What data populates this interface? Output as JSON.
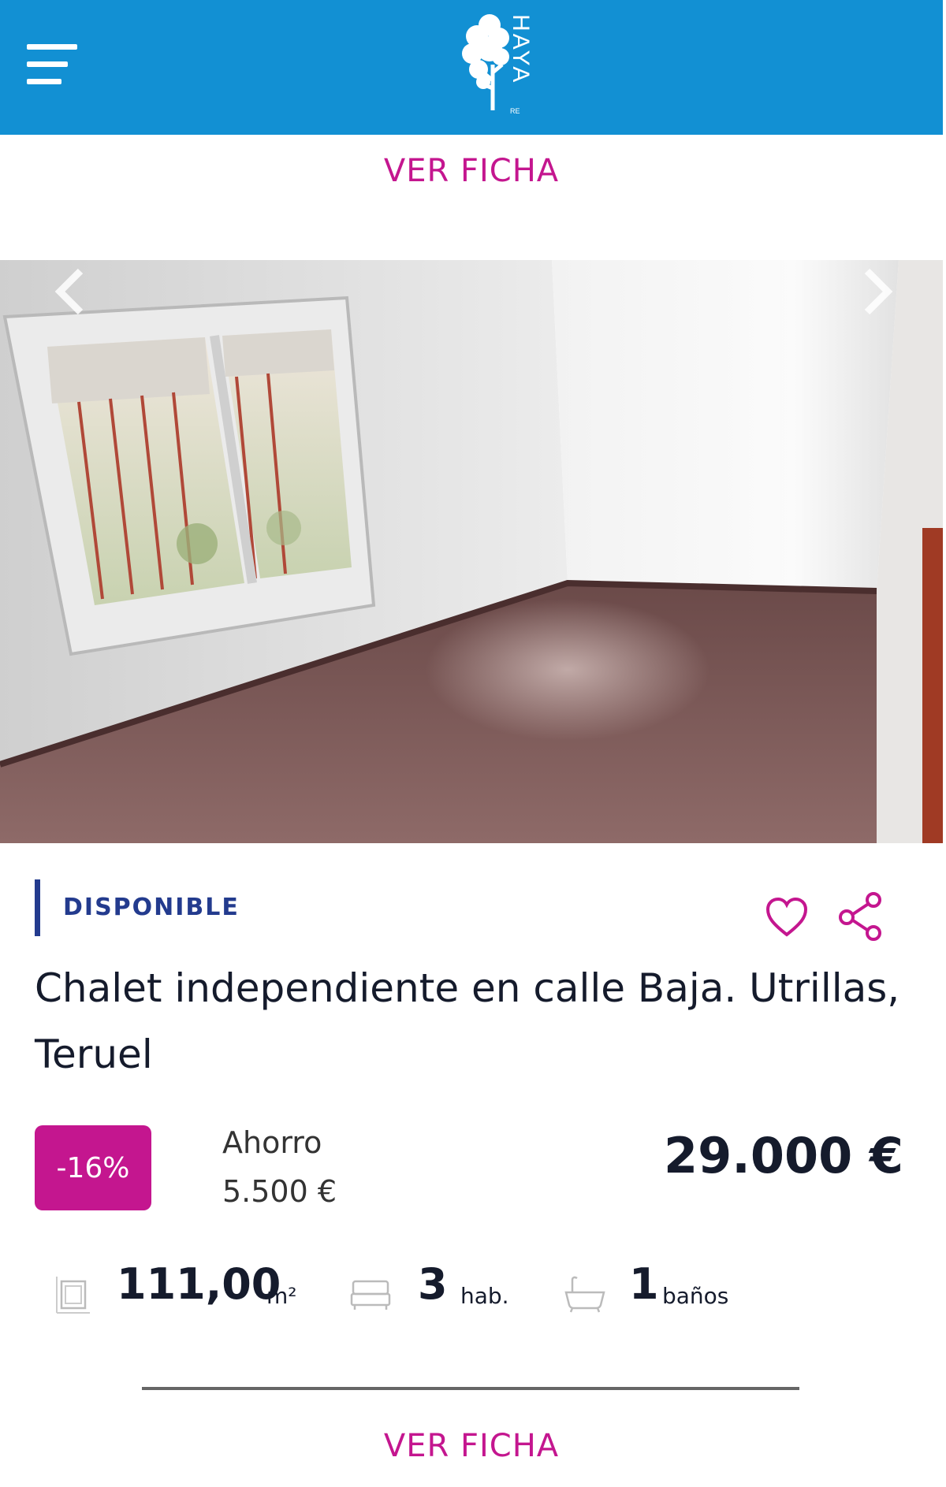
{
  "header": {
    "logo": {
      "brand": "HAYA",
      "sub": "RE"
    },
    "menu_icon": "hamburger-menu-icon"
  },
  "links": {
    "ver_ficha_top": "VER FICHA",
    "ver_ficha_bottom": "VER FICHA"
  },
  "gallery": {
    "prev_icon": "chevron-left-icon",
    "next_icon": "chevron-right-icon"
  },
  "listing": {
    "status": "DISPONIBLE",
    "title": "Chalet independiente en calle Baja. Utrillas, Teruel",
    "discount": "-16%",
    "savings_label": "Ahorro",
    "savings_value": "5.500 €",
    "price": "29.000 €",
    "features": {
      "area_value": "111,00",
      "area_unit": "m²",
      "rooms_value": "3",
      "rooms_unit": "hab.",
      "baths_value": "1",
      "baths_unit": "baños"
    }
  },
  "colors": {
    "header_bg": "#1290d3",
    "accent": "#c4168f",
    "status": "#233b8e",
    "text": "#151b2c"
  }
}
